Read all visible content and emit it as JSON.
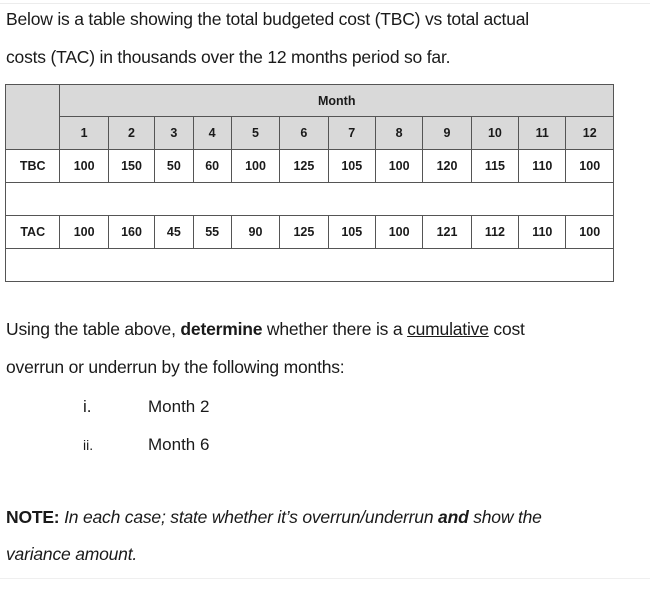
{
  "intro": {
    "line1": "Below is a table showing the total budgeted cost (TBC) vs total actual",
    "line2": "costs (TAC) in thousands over the 12 months period so far."
  },
  "table": {
    "group_header": "Month",
    "months": [
      "1",
      "2",
      "3",
      "4",
      "5",
      "6",
      "7",
      "8",
      "9",
      "10",
      "11",
      "12"
    ],
    "rows": [
      {
        "label": "TBC",
        "values": [
          "100",
          "150",
          "50",
          "60",
          "100",
          "125",
          "105",
          "100",
          "120",
          "115",
          "110",
          "100"
        ]
      },
      {
        "label": "TAC",
        "values": [
          "100",
          "160",
          "45",
          "55",
          "90",
          "125",
          "105",
          "100",
          "121",
          "112",
          "110",
          "100"
        ]
      }
    ]
  },
  "question": {
    "l1_pre": "Using the table above, ",
    "l1_bold": "determine",
    "l1_mid": " whether there is a ",
    "l1_underline": "cumulative",
    "l1_post": " cost",
    "line2": "overrun or underrun by the following months:",
    "items": [
      {
        "num": "i.",
        "text": "Month 2"
      },
      {
        "num": "ii.",
        "text": "Month 6"
      }
    ]
  },
  "note": {
    "label": "NOTE:",
    "l1_italic": " In each case; state whether it’s overrun/underrun ",
    "l1_bold_italic": "and",
    "l1_italic_end": " show the",
    "line2": "variance amount."
  }
}
